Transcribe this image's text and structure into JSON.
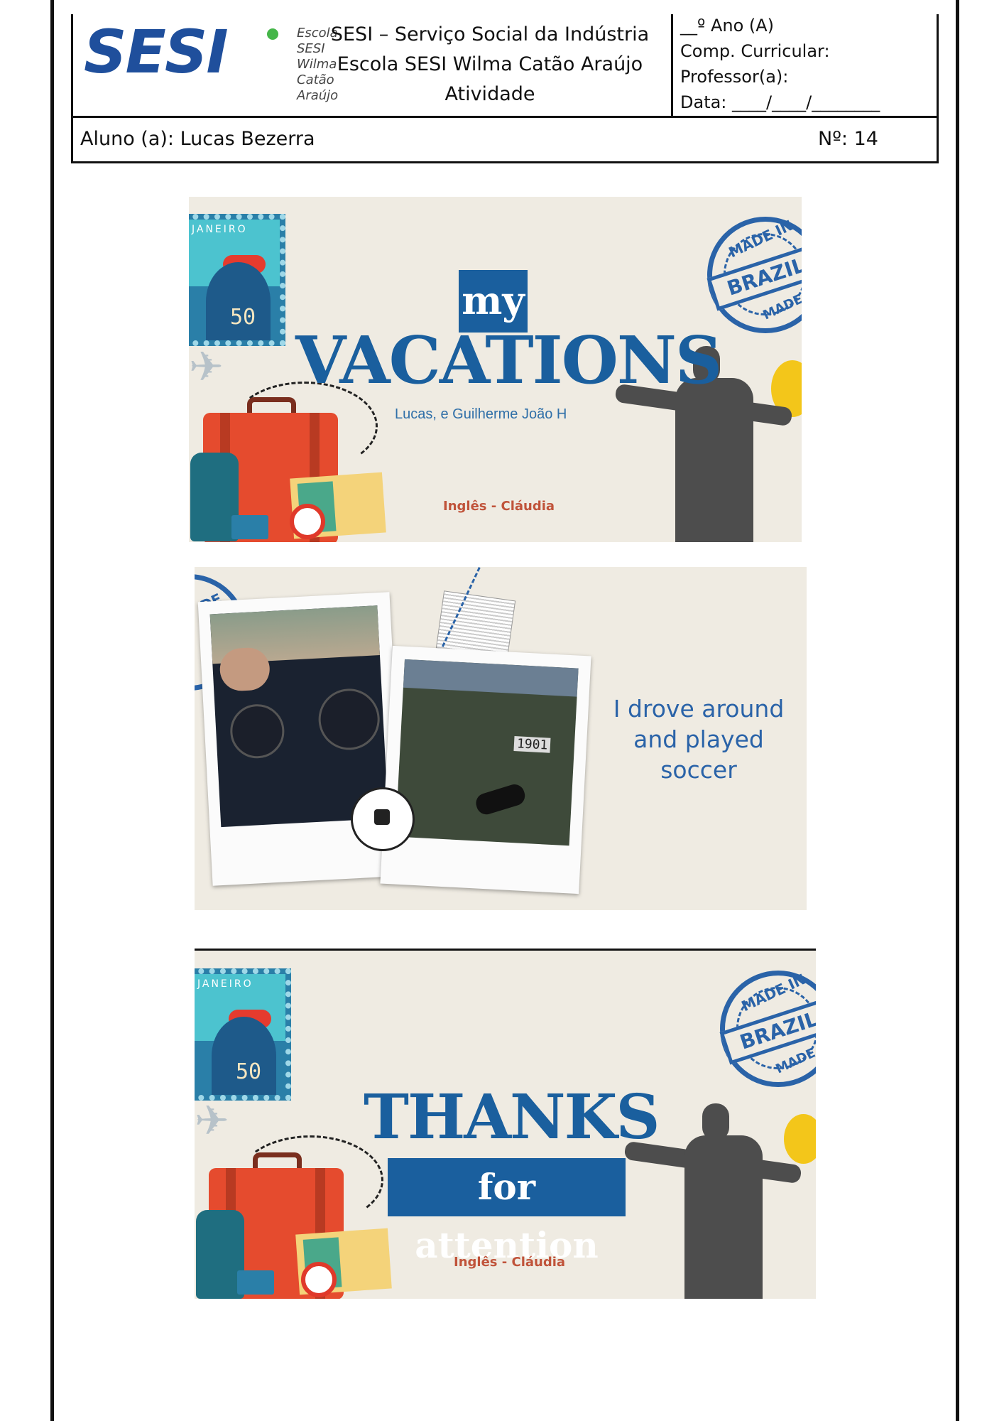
{
  "header": {
    "logo_text": "SESI",
    "logo_subtitle": [
      "Escola SESI",
      "Wilma Catão",
      "Araújo"
    ],
    "title_lines": [
      "SESI – Serviço Social da Indústria",
      "Escola SESI Wilma Catão Araújo",
      "Atividade"
    ],
    "grade": "__º Ano (A)",
    "subject_label": "Comp. Curricular:",
    "teacher_label": "Professor(a):",
    "date_label": "Data: ____/____/________"
  },
  "student": {
    "name": "Aluno (a): Lucas Bezerra",
    "number": "Nº: 14"
  },
  "slide1": {
    "stamp_city": "JANEIRO",
    "stamp_value": "50",
    "seal_top": "MADE IN",
    "seal_band": "BRAZIL",
    "seal_bottom": "MADE",
    "my": "my",
    "title": "VACATIONS",
    "authors": "Lucas, e Guilherme João H",
    "credit": "Inglês - Cláudia"
  },
  "slide2": {
    "seal_fragment": "DE IN",
    "scoreboard": "1901",
    "caption_lines": [
      "I drove around",
      "and played",
      "soccer"
    ]
  },
  "slide3": {
    "stamp_city": "JANEIRO",
    "stamp_value": "50",
    "seal_top": "MADE IN",
    "seal_band": "BRAZIL",
    "seal_bottom": "MADE",
    "title": "THANKS",
    "subtitle": "for attention",
    "credit": "Inglês - Cláudia"
  },
  "colors": {
    "brand_blue": "#1a5f9e",
    "slide_bg": "#efebe2",
    "credit_red": "#c0533a"
  }
}
